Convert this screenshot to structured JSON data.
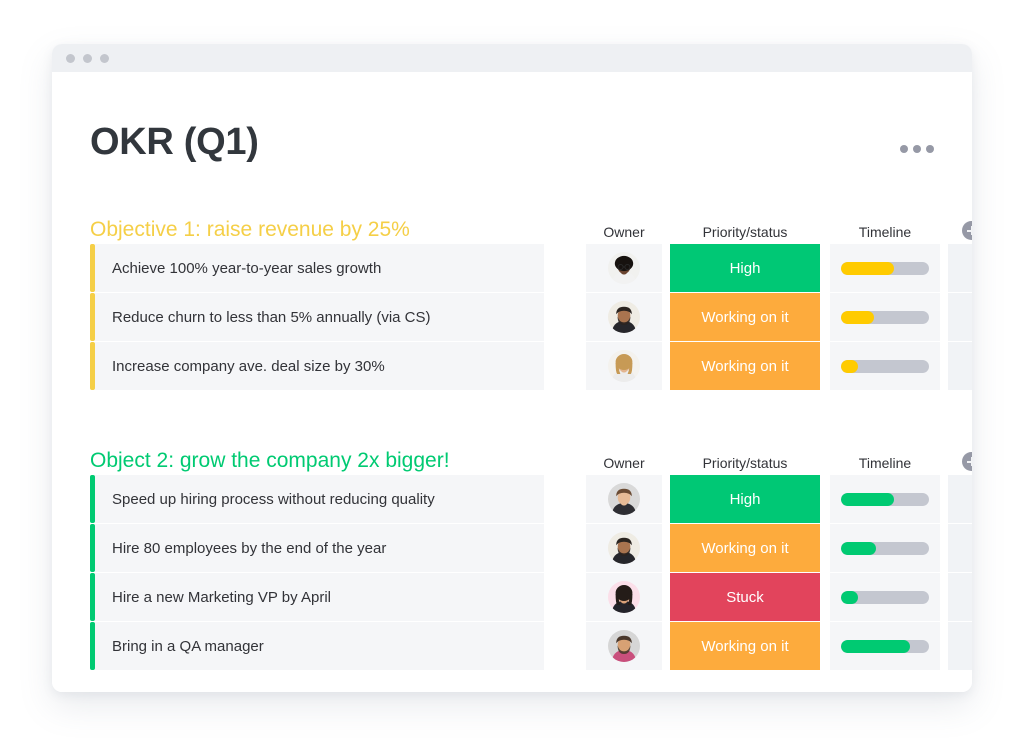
{
  "window": {
    "chrome_dots": 3
  },
  "header": {
    "title": "OKR (Q1)",
    "menu_icon": "kebab-menu-icon"
  },
  "columns": {
    "owner": "Owner",
    "status": "Priority/status",
    "timeline": "Timeline",
    "add": "add-column-icon"
  },
  "colors": {
    "objective_yellow": "#f5cf47",
    "objective_green": "#00ca72",
    "status_high": "#00c875",
    "status_working": "#fdab3d",
    "status_stuck": "#e2445c",
    "bar_track": "#c4c7d0",
    "bar_yellow": "#ffcb00",
    "bar_green": "#00ca72",
    "cell_bg": "#f5f6f8",
    "title_text": "#32373d"
  },
  "groups": [
    {
      "title": "Objective 1: raise revenue by 25%",
      "accent": "#f5cf47",
      "bar_color": "#ffcb00",
      "rows": [
        {
          "name": "Achieve 100% year-to-year sales growth",
          "owner": "avatar-woman-glasses",
          "status": "High",
          "status_color": "#00c875",
          "timeline_percent": 60
        },
        {
          "name": "Reduce churn to less than 5% annually (via CS)",
          "owner": "avatar-man-beard-black-shirt",
          "status": "Working on it",
          "status_color": "#fdab3d",
          "timeline_percent": 38
        },
        {
          "name": "Increase company ave. deal size by 30%",
          "owner": "avatar-woman-blonde",
          "status": "Working on it",
          "status_color": "#fdab3d",
          "timeline_percent": 19
        }
      ]
    },
    {
      "title": "Object 2: grow the company 2x bigger!",
      "accent": "#00ca72",
      "bar_color": "#00ca72",
      "rows": [
        {
          "name": "Speed up hiring process without reducing quality",
          "owner": "avatar-man-short-hair",
          "status": "High",
          "status_color": "#00c875",
          "timeline_percent": 60
        },
        {
          "name": "Hire 80 employees by the end of the year",
          "owner": "avatar-man-beard-black-shirt",
          "status": "Working on it",
          "status_color": "#fdab3d",
          "timeline_percent": 40
        },
        {
          "name": "Hire a new Marketing VP by April",
          "owner": "avatar-woman-dark-hair",
          "status": "Stuck",
          "status_color": "#e2445c",
          "timeline_percent": 19
        },
        {
          "name": "Bring in a QA manager",
          "owner": "avatar-man-beard-floral",
          "status": "Working on it",
          "status_color": "#fdab3d",
          "timeline_percent": 78
        }
      ]
    }
  ]
}
